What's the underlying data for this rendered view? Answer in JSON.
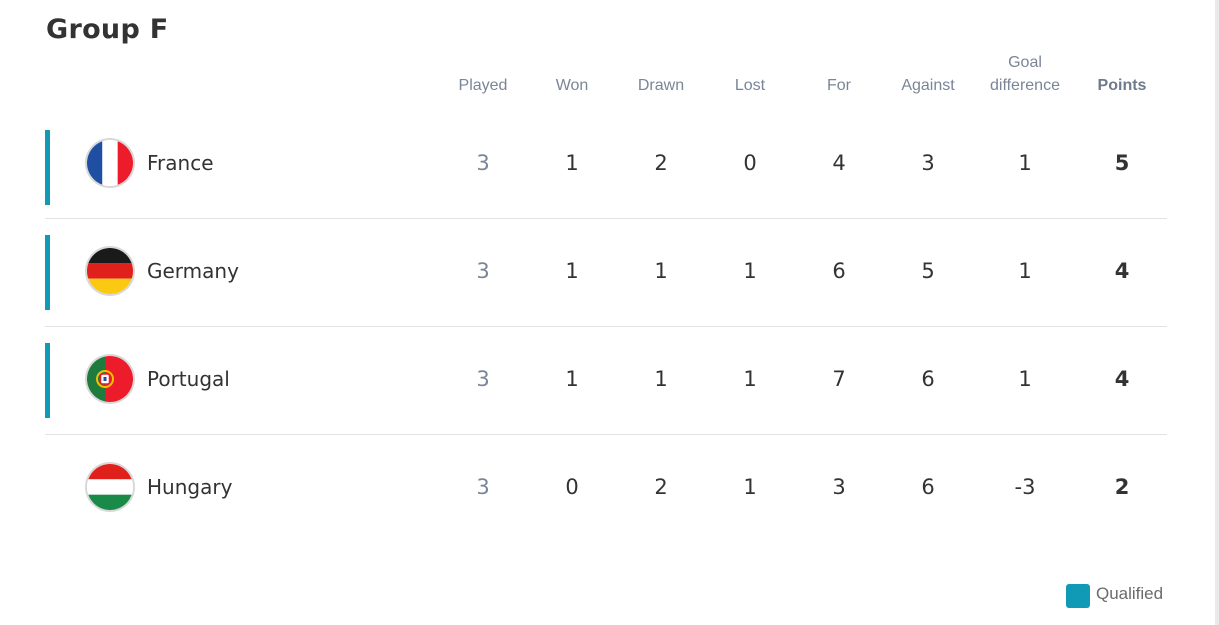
{
  "title": "Group F",
  "columns": [
    {
      "key": "played",
      "label": "Played"
    },
    {
      "key": "won",
      "label": "Won"
    },
    {
      "key": "drawn",
      "label": "Drawn"
    },
    {
      "key": "lost",
      "label": "Lost"
    },
    {
      "key": "for",
      "label": "For"
    },
    {
      "key": "against",
      "label": "Against"
    },
    {
      "key": "gd",
      "label": "Goal difference",
      "line1": "Goal",
      "line2": "difference"
    },
    {
      "key": "points",
      "label": "Points"
    }
  ],
  "teams": [
    {
      "name": "France",
      "flag": "france-flag-icon",
      "qualified": true,
      "played": "3",
      "won": "1",
      "drawn": "2",
      "lost": "0",
      "for": "4",
      "against": "3",
      "gd": "1",
      "points": "5"
    },
    {
      "name": "Germany",
      "flag": "germany-flag-icon",
      "qualified": true,
      "played": "3",
      "won": "1",
      "drawn": "1",
      "lost": "1",
      "for": "6",
      "against": "5",
      "gd": "1",
      "points": "4"
    },
    {
      "name": "Portugal",
      "flag": "portugal-flag-icon",
      "qualified": true,
      "played": "3",
      "won": "1",
      "drawn": "1",
      "lost": "1",
      "for": "7",
      "against": "6",
      "gd": "1",
      "points": "4"
    },
    {
      "name": "Hungary",
      "flag": "hungary-flag-icon",
      "qualified": false,
      "played": "3",
      "won": "0",
      "drawn": "2",
      "lost": "1",
      "for": "3",
      "against": "6",
      "gd": "-3",
      "points": "2"
    }
  ],
  "legend": {
    "label": "Qualified",
    "color": "#109ab5"
  },
  "colors": {
    "qualified": "#109ab5",
    "header_text": "#7a8597",
    "text": "#333333"
  }
}
